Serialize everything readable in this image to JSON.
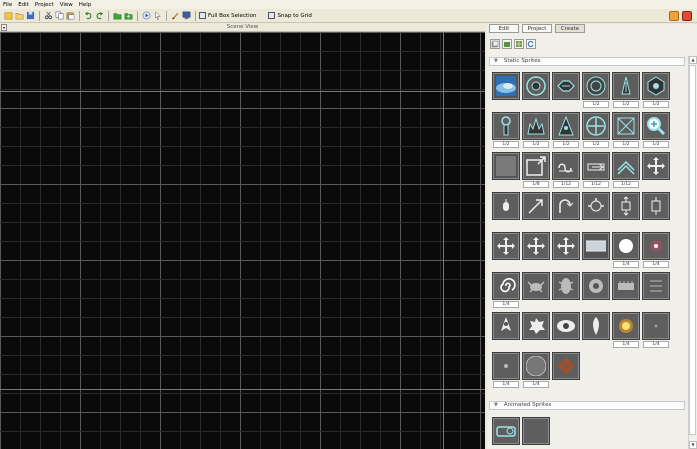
{
  "menu": [
    "File",
    "Edit",
    "Project",
    "View",
    "Help"
  ],
  "toolbar": {
    "full_box_selection": "Full Box Selection",
    "snap_to_grid": "Snap to Grid"
  },
  "scene": {
    "title": "Scene View"
  },
  "panel": {
    "tabs": [
      "Edit",
      "Project",
      "Create"
    ],
    "active_tab": "Create"
  },
  "sections": {
    "static": "Static Sprites",
    "animated": "Animated Sprites"
  },
  "static_sprites": [
    {
      "icon": "nebula-sprite",
      "label": ""
    },
    {
      "icon": "ring-target-sprite",
      "label": ""
    },
    {
      "icon": "capsule-sprite",
      "label": ""
    },
    {
      "icon": "turret-sprite",
      "label": "1/2"
    },
    {
      "icon": "spike-ship-sprite",
      "label": "1/2"
    },
    {
      "icon": "shield-sprite",
      "label": "1/2"
    },
    {
      "icon": "pillar-sprite",
      "label": "1/2"
    },
    {
      "icon": "crown-sprite",
      "label": "1/2"
    },
    {
      "icon": "fin-ship-sprite",
      "label": "1/2"
    },
    {
      "icon": "crosshair-sprite",
      "label": "1/2"
    },
    {
      "icon": "star-frame-sprite",
      "label": "1/2"
    },
    {
      "icon": "magnifier-sprite",
      "label": "1/2"
    },
    {
      "icon": "gray-square-sprite",
      "label": ""
    },
    {
      "icon": "corner-arrow-sprite",
      "label": "1/8"
    },
    {
      "icon": "loop-sprite",
      "label": "1/12"
    },
    {
      "icon": "arrow-box-sprite",
      "label": "1/12"
    },
    {
      "icon": "chevron-sprite",
      "label": "1/12"
    },
    {
      "icon": "move-cross-sprite",
      "label": ""
    },
    {
      "icon": "mouse-sprite",
      "label": ""
    },
    {
      "icon": "diagonal-arrow-sprite",
      "label": ""
    },
    {
      "icon": "turn-arrow-sprite",
      "label": ""
    },
    {
      "icon": "spread-arrows-sprite",
      "label": ""
    },
    {
      "icon": "vertical-arrows-sprite",
      "label": ""
    },
    {
      "icon": "updown-box-sprite",
      "label": ""
    },
    {
      "icon": "move-cross-sprite",
      "label": ""
    },
    {
      "icon": "move-cross-sprite",
      "label": ""
    },
    {
      "icon": "move-cross-sprite",
      "label": ""
    },
    {
      "icon": "light-bar-sprite",
      "label": ""
    },
    {
      "icon": "white-orb-sprite",
      "label": "1/4"
    },
    {
      "icon": "pink-spark-sprite",
      "label": "1/4"
    },
    {
      "icon": "spiral-sprite",
      "label": "1/4"
    },
    {
      "icon": "crab-sprite",
      "label": ""
    },
    {
      "icon": "beetle-sprite",
      "label": ""
    },
    {
      "icon": "gear-blob-sprite",
      "label": ""
    },
    {
      "icon": "tank-sprite",
      "label": ""
    },
    {
      "icon": "stripes-sprite",
      "label": ""
    },
    {
      "icon": "alien-ship-sprite",
      "label": ""
    },
    {
      "icon": "splat-sprite",
      "label": ""
    },
    {
      "icon": "eye-ship-sprite",
      "label": ""
    },
    {
      "icon": "rocket-sprite",
      "label": ""
    },
    {
      "icon": "fire-orb-sprite",
      "label": "1/4"
    },
    {
      "icon": "faint-dot-sprite",
      "label": "1/4"
    },
    {
      "icon": "small-dot-sprite",
      "label": "1/4"
    },
    {
      "icon": "circle-outline-sprite",
      "label": "1/4"
    },
    {
      "icon": "brown-cross-sprite",
      "label": ""
    }
  ],
  "animated_sprites": [
    {
      "icon": "battery-sprite",
      "label": ""
    },
    {
      "icon": "crescent-sprite",
      "label": ""
    }
  ],
  "colors": {
    "scene_bg": "#0a0a0a",
    "grid_minor": "#2a2a2a",
    "grid_major": "#5a5a5a",
    "cyan": "#9be3e6"
  }
}
